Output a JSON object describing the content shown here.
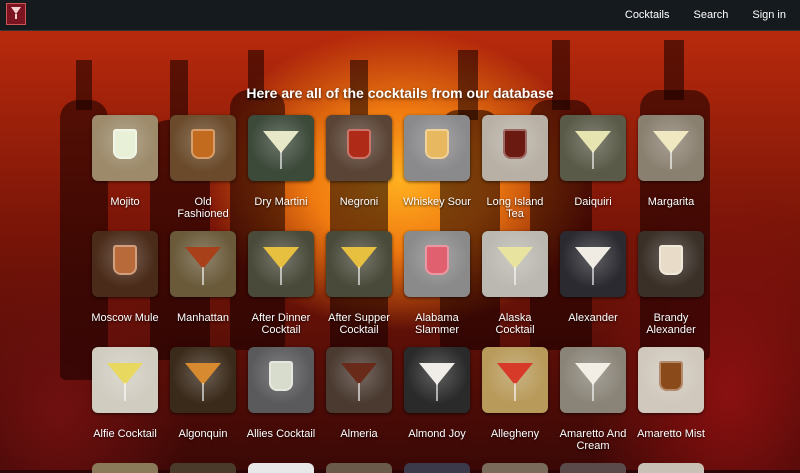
{
  "header": {
    "logo": "cocktail-logo",
    "nav": [
      "Cocktails",
      "Search",
      "Sign in"
    ]
  },
  "main": {
    "heading": "Here are all of the cocktails from our database",
    "cocktails": [
      {
        "name": "Mojito",
        "bg": "#9c8a6a",
        "drink": "#e8f0d8",
        "style": "tumbler"
      },
      {
        "name": "Old Fashioned",
        "bg": "#6a4a2a",
        "drink": "#c26a1e",
        "style": "tumbler"
      },
      {
        "name": "Dry Martini",
        "bg": "#3c4a3a",
        "drink": "#e6e8c8",
        "style": "martini"
      },
      {
        "name": "Negroni",
        "bg": "#5a4436",
        "drink": "#b02a18",
        "style": "tumbler"
      },
      {
        "name": "Whiskey Sour",
        "bg": "#8a8a8c",
        "drink": "#e8b860",
        "style": "tumbler"
      },
      {
        "name": "Long Island Tea",
        "bg": "#b8b0a4",
        "drink": "#6a1a10",
        "style": "tumbler"
      },
      {
        "name": "Daiquiri",
        "bg": "#5a5a48",
        "drink": "#e6e4b0",
        "style": "martini"
      },
      {
        "name": "Margarita",
        "bg": "#8a8070",
        "drink": "#efe8c0",
        "style": "martini"
      },
      {
        "name": "Moscow Mule",
        "bg": "#4a2a18",
        "drink": "#b86a3a",
        "style": "tumbler"
      },
      {
        "name": "Manhattan",
        "bg": "#6a5a3a",
        "drink": "#a8401a",
        "style": "martini"
      },
      {
        "name": "After Dinner Cocktail",
        "bg": "#4a4a3a",
        "drink": "#e8c040",
        "style": "martini"
      },
      {
        "name": "After Supper Cocktail",
        "bg": "#4a4a3a",
        "drink": "#e8c040",
        "style": "martini"
      },
      {
        "name": "Alabama Slammer",
        "bg": "#8a8a8a",
        "drink": "#e06070",
        "style": "tumbler"
      },
      {
        "name": "Alaska Cocktail",
        "bg": "#bab8b0",
        "drink": "#e8e4a0",
        "style": "martini"
      },
      {
        "name": "Alexander",
        "bg": "#2a2a30",
        "drink": "#f0ece4",
        "style": "martini"
      },
      {
        "name": "Brandy Alexander",
        "bg": "#3a3028",
        "drink": "#e8dcc8",
        "style": "tumbler"
      },
      {
        "name": "Alfie Cocktail",
        "bg": "#d0ccc0",
        "drink": "#e8d860",
        "style": "martini"
      },
      {
        "name": "Algonquin",
        "bg": "#3a2a1a",
        "drink": "#d88a30",
        "style": "martini"
      },
      {
        "name": "Allies Cocktail",
        "bg": "#5a5a5c",
        "drink": "#d8dccc",
        "style": "tumbler"
      },
      {
        "name": "Almeria",
        "bg": "#4a3a30",
        "drink": "#6a2a1a",
        "style": "martini"
      },
      {
        "name": "Almond Joy",
        "bg": "#2a2a2a",
        "drink": "#f0ece8",
        "style": "martini"
      },
      {
        "name": "Allegheny",
        "bg": "#b89a5a",
        "drink": "#d83a2a",
        "style": "martini"
      },
      {
        "name": "Amaretto And Cream",
        "bg": "#8a8478",
        "drink": "#f2eee6",
        "style": "martini"
      },
      {
        "name": "Amaretto Mist",
        "bg": "#d0c8bc",
        "drink": "#8a4a1a",
        "style": "tumbler"
      }
    ]
  }
}
